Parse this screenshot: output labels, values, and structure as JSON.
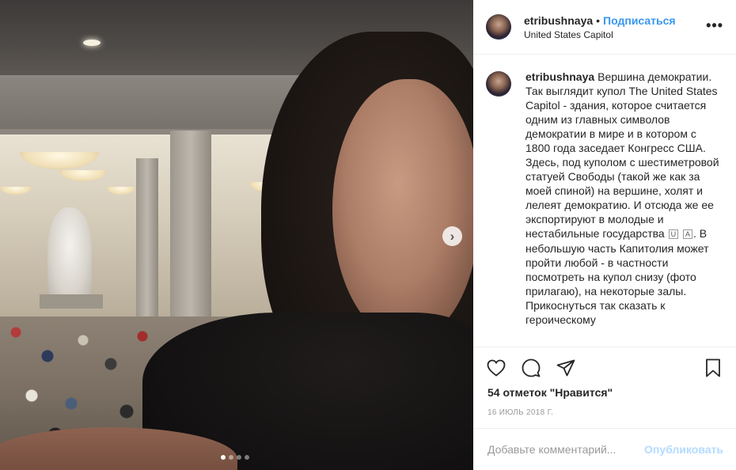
{
  "post": {
    "username": "etribushnaya",
    "separator": "•",
    "follow_label": "Подписаться",
    "location": "United States Capitol",
    "more_label": "•••",
    "caption_user": "etribushnaya",
    "caption_text_1": "Вершина демократии. Так выглядит купол The United States Capitol - здания, которое считается одним из главных символов демократии в мире и в котором с 1800 года заседает Конгресс США. Здесь, под куполом с шестиметровой статуей Свободы (такой же как за моей спиной) на вершине, холят и лелеят демократию. И отсюда же ее экспортируют в молодые и нестабильные государства",
    "flag_letters": [
      "U",
      "A"
    ],
    "caption_text_2": ". В небольшую часть Капитолия может пройти любой - в частности посмотреть на купол снизу (фото прилагаю), на некоторые залы. Прикоснуться так сказать к героическому",
    "likes": "54 отметок \"Нравится\"",
    "date": "16 июль 2018 г.",
    "comment_placeholder": "Добавьте комментарий...",
    "publish_label": "Опубликовать"
  },
  "carousel": {
    "next_icon": "›",
    "dots": [
      true,
      false,
      false,
      false
    ]
  },
  "icons": {
    "like": "heart-icon",
    "comment": "comment-icon",
    "share": "share-icon",
    "save": "bookmark-icon",
    "next": "chevron-right-icon"
  },
  "colors": {
    "link": "#3897f0",
    "publish_disabled": "#b3dbff",
    "text": "#262626",
    "muted": "#999999",
    "divider": "#efefef"
  }
}
